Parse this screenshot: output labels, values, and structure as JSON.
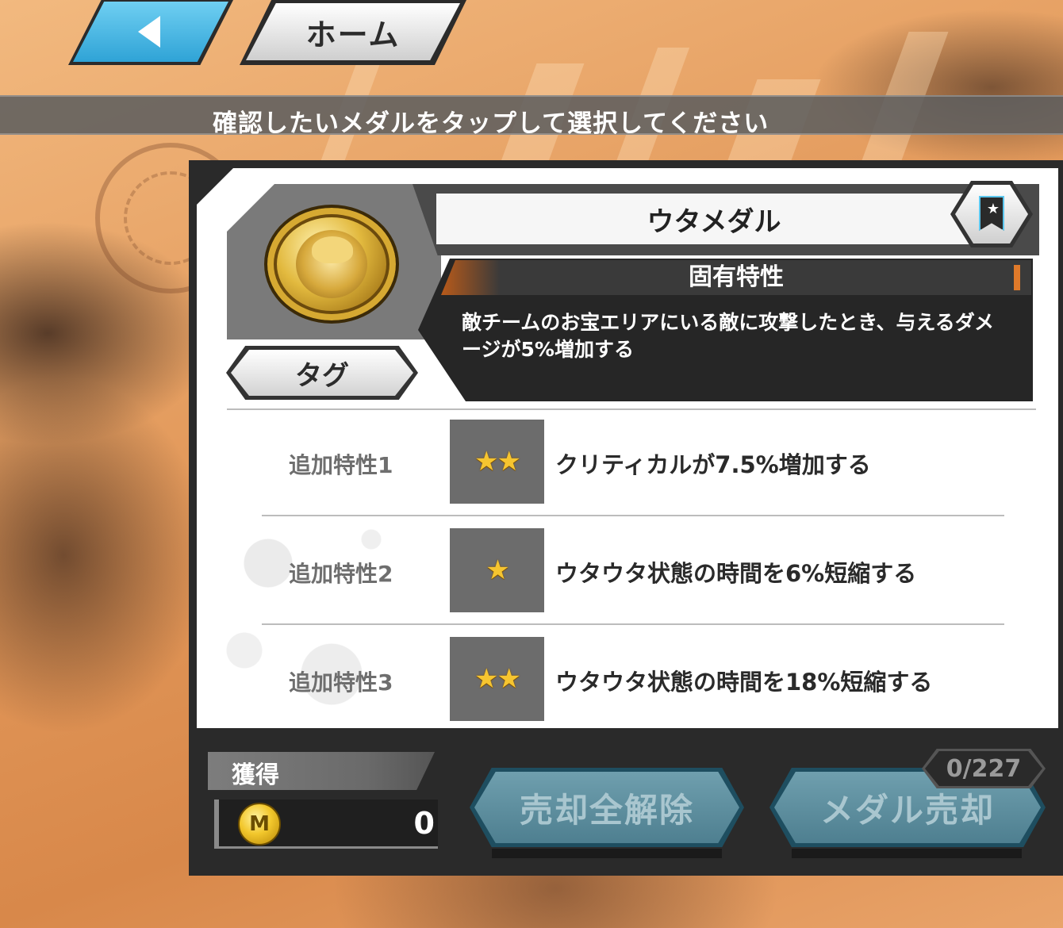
{
  "nav": {
    "home_label": "ホーム"
  },
  "banner": {
    "instruction": "確認したいメダルをタップして選択してください"
  },
  "medal": {
    "name": "ウタメダル",
    "tag_label": "タグ"
  },
  "unique_trait": {
    "title": "固有特性",
    "description": "敵チームのお宝エリアにいる敵に攻撃したとき、与えるダメージが5%増加する"
  },
  "extra_traits": [
    {
      "label": "追加特性1",
      "stars": "★★",
      "text": "クリティカルが7.5%増加する"
    },
    {
      "label": "追加特性2",
      "stars": "★",
      "text": "ウタウタ状態の時間を6%短縮する"
    },
    {
      "label": "追加特性3",
      "stars": "★★",
      "text": "ウタウタ状態の時間を18%短縮する"
    }
  ],
  "acquire": {
    "label": "獲得",
    "currency_icon_letter": "M",
    "value": "0"
  },
  "actions": {
    "deselect_all_label": "売却全解除",
    "sell_label": "メダル売却",
    "count": "0/227"
  },
  "colors": {
    "accent_blue": "#2fa3d6",
    "accent_orange": "#e07a2a",
    "star_gold": "#f6c530",
    "disabled_button": "#5f8f9f"
  }
}
